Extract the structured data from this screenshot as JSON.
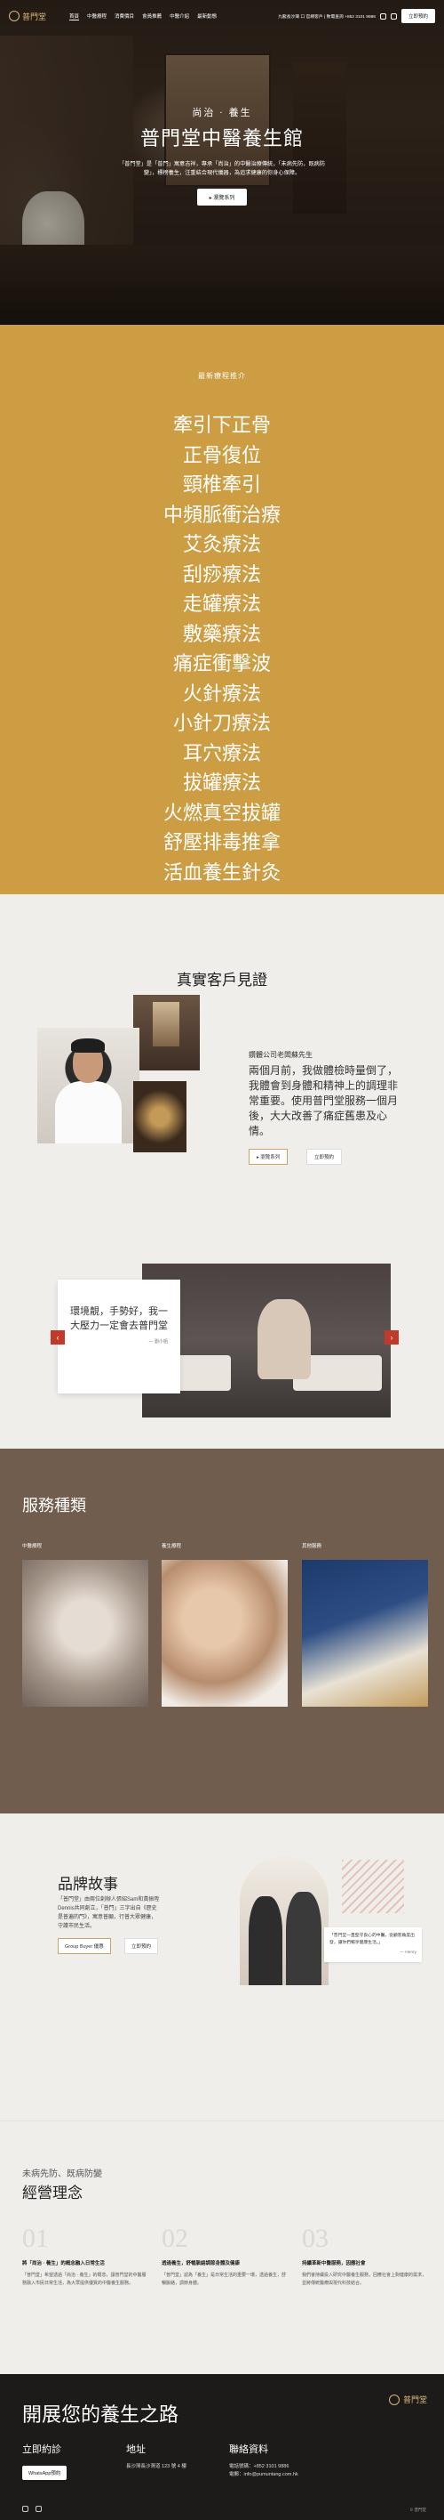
{
  "header": {
    "logo_text": "普門堂",
    "nav": [
      "首頁",
      "中醫療程",
      "消費價目",
      "會員推薦",
      "中醫介紹",
      "最新動態"
    ],
    "phone": "九龍長沙灣 口 官網客戶 | 致電查詢 +852 3101 9886",
    "cta": "立即預約"
  },
  "hero": {
    "sub": "尚治 · 養生",
    "title": "普門堂中醫養生館",
    "desc": "「普門堂」是「普門」寓意吉祥，專承「尚治」的中醫治療傳統，「未病先防，既病防變」，標榜養生，注重結合現代儀器，為追求健康的你身心保障。",
    "button": "瀏覽系列"
  },
  "treatments": {
    "heading": "最新療程推介",
    "items": [
      "牽引下正骨",
      "正骨復位",
      "頸椎牽引",
      "中頻脈衝治療",
      "艾灸療法",
      "刮痧療法",
      "走罐療法",
      "敷藥療法",
      "痛症衝擊波",
      "火針療法",
      "小針刀療法",
      "耳穴療法",
      "拔罐療法",
      "火燃真空拔罐",
      "舒壓排毒推拿",
      "活血養生針灸"
    ]
  },
  "testimonials": {
    "title": "真實客戶見證",
    "name": "鑽體公司老闆蘇先生",
    "quote": "兩個月前，我做體檢時量倒了，我體會到身體和精神上的調理非常重要。使用普門堂服務一個月後，大大改善了痛症舊患及心情。",
    "btn_primary": "瀏覽系列",
    "btn_secondary": "立即預約",
    "card_text": "環境靚，手勢好，我一大壓力一定會去普門堂",
    "card_by": "— 劉小姐",
    "prev": "‹",
    "next": "›"
  },
  "services": {
    "title": "服務種類",
    "items": [
      {
        "label": "中醫療程"
      },
      {
        "label": "養生療程"
      },
      {
        "label": "其他服務"
      }
    ]
  },
  "brand": {
    "title": "品牌故事",
    "text": "「普門堂」由兩位創辦人張紹Sam和黃振陞Dennis共同創立，「普門」三字出自《歷史是普遍的門》，寓意普願，行普大眾健康，守護市民生活。",
    "btn_primary": "Group Buyer 優惠",
    "btn_secondary": "立即預約",
    "quote": "「普門堂一直堅守良心的中醫，從顧客角度出發，讓你們暢享健康生活。」",
    "quote_by": "— Henry"
  },
  "philosophy": {
    "sub": "未病先防、既病防變",
    "title": "經營理念",
    "cols": [
      {
        "num": "01",
        "title": "將「尚治 · 養生」的概念融入日常生活",
        "desc": "「普門堂」希望透過「尚治 · 養生」的概念，讓普門堂的中醫服務融入市民日常生活，為大眾提供優質的中醫養生服務。"
      },
      {
        "num": "02",
        "title": "透過養生，舒暢脈絡調節身體及健康",
        "desc": "「普門堂」認為「養生」是日常生活的重要一環，透過養生，舒暢脈絡，調節身體。"
      },
      {
        "num": "03",
        "title": "持續革新中醫服務，因應社會",
        "desc": "我們會持續投入研究中醫養生服務，回應社會上對健康的需求，並將傳統醫療與現代科技結合。"
      }
    ]
  },
  "footer": {
    "title": "開展您的養生之路",
    "logo_text": "普門堂",
    "col1_h": "立即約診",
    "col1_btn": "WhatsApp預約",
    "col2_h": "地址",
    "col2_text": "長沙灣長沙灣道 123 號 4 樓",
    "col3_h": "聯絡資料",
    "col3_phone": "電話號碼：+852 3101 9886",
    "col3_email": "電郵：info@pumuntang.com.hk",
    "copyright": "© 普門堂"
  }
}
